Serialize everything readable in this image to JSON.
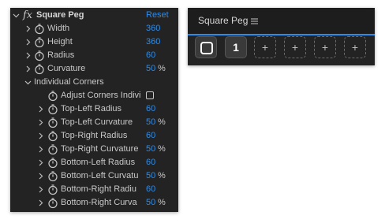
{
  "effect_panel": {
    "effect_name": "Square Peg",
    "fx_glyph": "fx",
    "reset_label": "Reset",
    "properties": [
      {
        "label": "Width",
        "value": "360",
        "unit": ""
      },
      {
        "label": "Height",
        "value": "360",
        "unit": ""
      },
      {
        "label": "Radius",
        "value": "60",
        "unit": ""
      },
      {
        "label": "Curvature",
        "value": "50",
        "unit": "%"
      }
    ],
    "group_label": "Individual Corners",
    "adjust_label": "Adjust Corners Indivi",
    "adjust_checked": false,
    "corners": [
      {
        "label": "Top-Left Radius",
        "value": "60",
        "unit": ""
      },
      {
        "label": "Top-Left Curvature",
        "value": "50",
        "unit": "%"
      },
      {
        "label": "Top-Right Radius",
        "value": "60",
        "unit": ""
      },
      {
        "label": "Top-Right Curvature",
        "value": "50",
        "unit": "%"
      },
      {
        "label": "Bottom-Left Radius",
        "value": "60",
        "unit": ""
      },
      {
        "label": "Bottom-Left Curvatu",
        "value": "50",
        "unit": "%"
      },
      {
        "label": "Bottom-Right Radiu",
        "value": "60",
        "unit": ""
      },
      {
        "label": "Bottom-Right Curva",
        "value": "50",
        "unit": "%"
      }
    ]
  },
  "square_peg_panel": {
    "title": "Square Peg",
    "menu_icon": "hamburger-menu-icon",
    "slot_1_icon": "rounded-square-icon",
    "slot_2_label": "1",
    "empty_slot_label": "+"
  },
  "colors": {
    "panel_bg": "#232323",
    "value_blue": "#2d8ceb",
    "text": "#c8c8c8"
  }
}
